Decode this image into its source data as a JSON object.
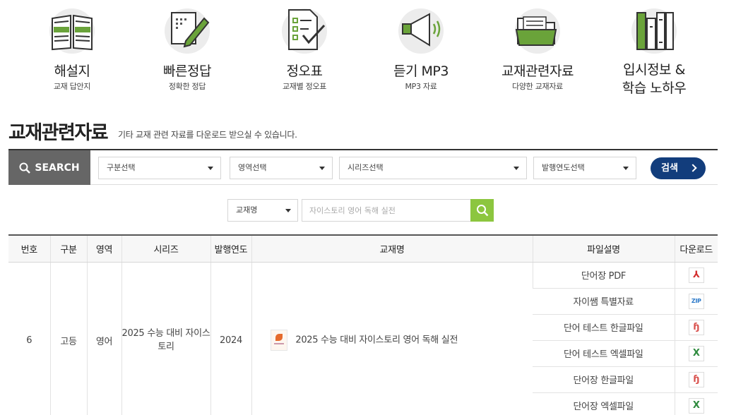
{
  "nav": [
    {
      "title": "해설지",
      "sub": "교재 답안지",
      "icon": "open-book-icon"
    },
    {
      "title": "빠른정답",
      "sub": "정확한 정답",
      "icon": "pencil-paper-icon"
    },
    {
      "title": "정오표",
      "sub": "교재별 정오표",
      "icon": "checklist-icon"
    },
    {
      "title": "듣기 MP3",
      "sub": "MP3 자료",
      "icon": "speaker-icon"
    },
    {
      "title": "교재관련자료",
      "sub": "다양한 교재자료",
      "icon": "folder-icon"
    },
    {
      "title_line1": "입시정보 &",
      "title_line2": "학습 노하우",
      "icon": "bookshelf-icon"
    }
  ],
  "section": {
    "title": "교재관련자료",
    "desc": "기타 교재 관련 자료를 다운로드 받으실 수 있습니다."
  },
  "search": {
    "label": "SEARCH",
    "selects": [
      "구분선택",
      "영역선택",
      "시리즈선택",
      "발행연도선택"
    ],
    "button": "검색",
    "keyword_select": "교재명",
    "keyword_placeholder": "자이스토리 영어 독해 실전"
  },
  "table": {
    "headers": [
      "번호",
      "구분",
      "영역",
      "시리즈",
      "발행연도",
      "교재명",
      "파일설명",
      "다운로드"
    ],
    "row": {
      "no": "6",
      "category": "고등",
      "area": "영어",
      "series": "2025 수능 대비 자이스토리",
      "year": "2024",
      "book": "2025 수능 대비 자이스토리 영어 독해 실전"
    },
    "files": [
      {
        "desc": "단어장 PDF",
        "type": "pdf",
        "glyph": "⅄"
      },
      {
        "desc": "자이쌤 특별자료",
        "type": "zip",
        "glyph": "ZIP"
      },
      {
        "desc": "단어 테스트 한글파일",
        "type": "hwp",
        "glyph": "ɧ"
      },
      {
        "desc": "단어 테스트 엑셀파일",
        "type": "xls",
        "glyph": "X"
      },
      {
        "desc": "단어장 한글파일",
        "type": "hwp",
        "glyph": "ɧ"
      },
      {
        "desc": "단어장 엑셀파일",
        "type": "xls",
        "glyph": "X"
      }
    ]
  },
  "colors": {
    "accent_green": "#8cc63f",
    "navy": "#123d7c",
    "search_gray": "#666666"
  }
}
